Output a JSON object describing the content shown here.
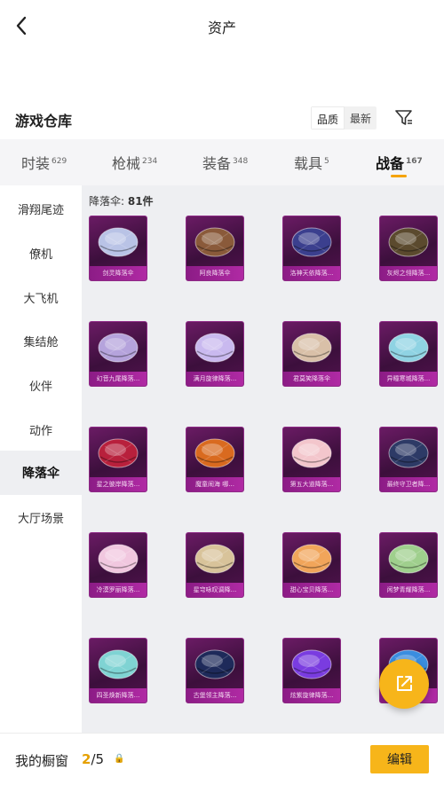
{
  "header": {
    "title": "资产",
    "back_icon": "chevron-left-icon"
  },
  "warehouse": {
    "title": "游戏仓库",
    "sort_options": [
      "品质",
      "最新"
    ],
    "filter_icon": "filter-icon"
  },
  "tabs": [
    {
      "label": "时装",
      "count": "629"
    },
    {
      "label": "枪械",
      "count": "234"
    },
    {
      "label": "装备",
      "count": "348"
    },
    {
      "label": "载具",
      "count": "5"
    },
    {
      "label": "战备",
      "count": "167"
    }
  ],
  "active_tab": "战备",
  "sidebar": [
    {
      "label": "滑翔尾迹"
    },
    {
      "label": "僚机"
    },
    {
      "label": "大飞机"
    },
    {
      "label": "集结舱"
    },
    {
      "label": "伙伴"
    },
    {
      "label": "动作"
    },
    {
      "label": "降落伞"
    },
    {
      "label": "大厅场景"
    }
  ],
  "active_sidebar": "降落伞",
  "category": {
    "name": "降落伞: ",
    "count": "81件"
  },
  "items": [
    {
      "name": "剑灵降落伞",
      "color": "#b9c3e6"
    },
    {
      "name": "阿良降落伞",
      "color": "#8a5a3a"
    },
    {
      "name": "洛神天依降落...",
      "color": "#3b3f8e"
    },
    {
      "name": "灰烬之翎降落...",
      "color": "#5b4a2e"
    },
    {
      "name": "幻音九尾降落...",
      "color": "#b5a3dc"
    },
    {
      "name": "满月旋律降落...",
      "color": "#c9b9ef"
    },
    {
      "name": "君莫笑降落伞",
      "color": "#d9c0a8"
    },
    {
      "name": "异瞳寒城降落...",
      "color": "#8fd3e3"
    },
    {
      "name": "星之彼岸降落...",
      "color": "#b8203c"
    },
    {
      "name": "魔童闹海 哪...",
      "color": "#d96a1f"
    },
    {
      "name": "第五大道降落...",
      "color": "#f3c6cc"
    },
    {
      "name": "最终守卫者降...",
      "color": "#2d3a66"
    },
    {
      "name": "冷漠罗丽降落...",
      "color": "#f1c7df"
    },
    {
      "name": "星穹咏叹调降...",
      "color": "#d8c39a"
    },
    {
      "name": "甜心宝贝降落...",
      "color": "#f1a55a"
    },
    {
      "name": "闲梦青耀降落...",
      "color": "#9fcf8d"
    },
    {
      "name": "四圣焕新降落...",
      "color": "#7fd3d3"
    },
    {
      "name": "古堡领主降落...",
      "color": "#1e2a5a"
    },
    {
      "name": "炫紫旋律降落...",
      "color": "#7a3ce0"
    },
    {
      "name": "",
      "color": "#3a8de0"
    }
  ],
  "bottom": {
    "label": "我的橱窗",
    "current": "2",
    "total": "/5",
    "lock": "🔒",
    "edit_label": "编辑"
  },
  "colors": {
    "accent": "#f7b51a",
    "card_bg": "#4a1348",
    "card_caption": "#a52a9c"
  }
}
